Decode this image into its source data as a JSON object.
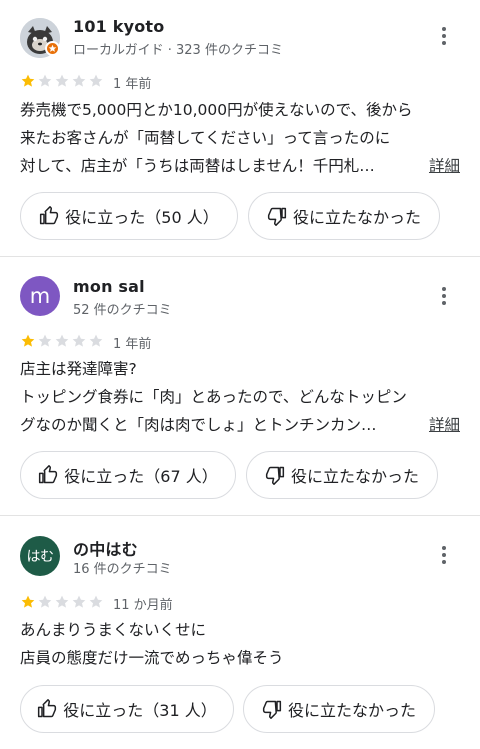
{
  "reviews": [
    {
      "name": "101 kyoto",
      "meta": "ローカルガイド · 323 件のクチコミ",
      "rating": 1,
      "time": "1 年前",
      "lines": [
        "券売機で5,000円とか10,000円が使えないので、後から",
        "来たお客さんが「両替してください」って言ったのに",
        "対して、店主が「うちは両替はしません！千円札…"
      ],
      "more_label": "詳細",
      "helpful_label": "役に立った（50 人）",
      "not_helpful_label": "役に立たなかった"
    },
    {
      "name": "mon sal",
      "avatar_letter": "m",
      "meta": "52 件のクチコミ",
      "rating": 1,
      "time": "1 年前",
      "lines": [
        "店主は発達障害?",
        "トッピング食券に「肉」とあったので、どんなトッピン",
        "グなのか聞くと「肉は肉でしょ」とトンチンカン…"
      ],
      "more_label": "詳細",
      "helpful_label": "役に立った（67 人）",
      "not_helpful_label": "役に立たなかった"
    },
    {
      "name": "の中はむ",
      "avatar_text": "はむ",
      "meta": "16 件のクチコミ",
      "rating": 1,
      "time": "11 か月前",
      "lines": [
        "あんまりうまくないくせに",
        "店員の態度だけ一流でめっちゃ偉そう"
      ],
      "helpful_label": "役に立った（31 人）",
      "not_helpful_label": "役に立たなかった"
    }
  ],
  "colors": {
    "star_filled": "#fbbc04",
    "star_empty": "#dadce0",
    "guide_badge": "#e8710a",
    "avatar_purple": "#7e57c2",
    "avatar_green": "#1e5b47"
  },
  "icons": {
    "more": "more-vert-icon",
    "helpful": "thumb-up-icon",
    "not_helpful": "thumb-down-icon",
    "local_guide": "local-guide-star-icon"
  }
}
